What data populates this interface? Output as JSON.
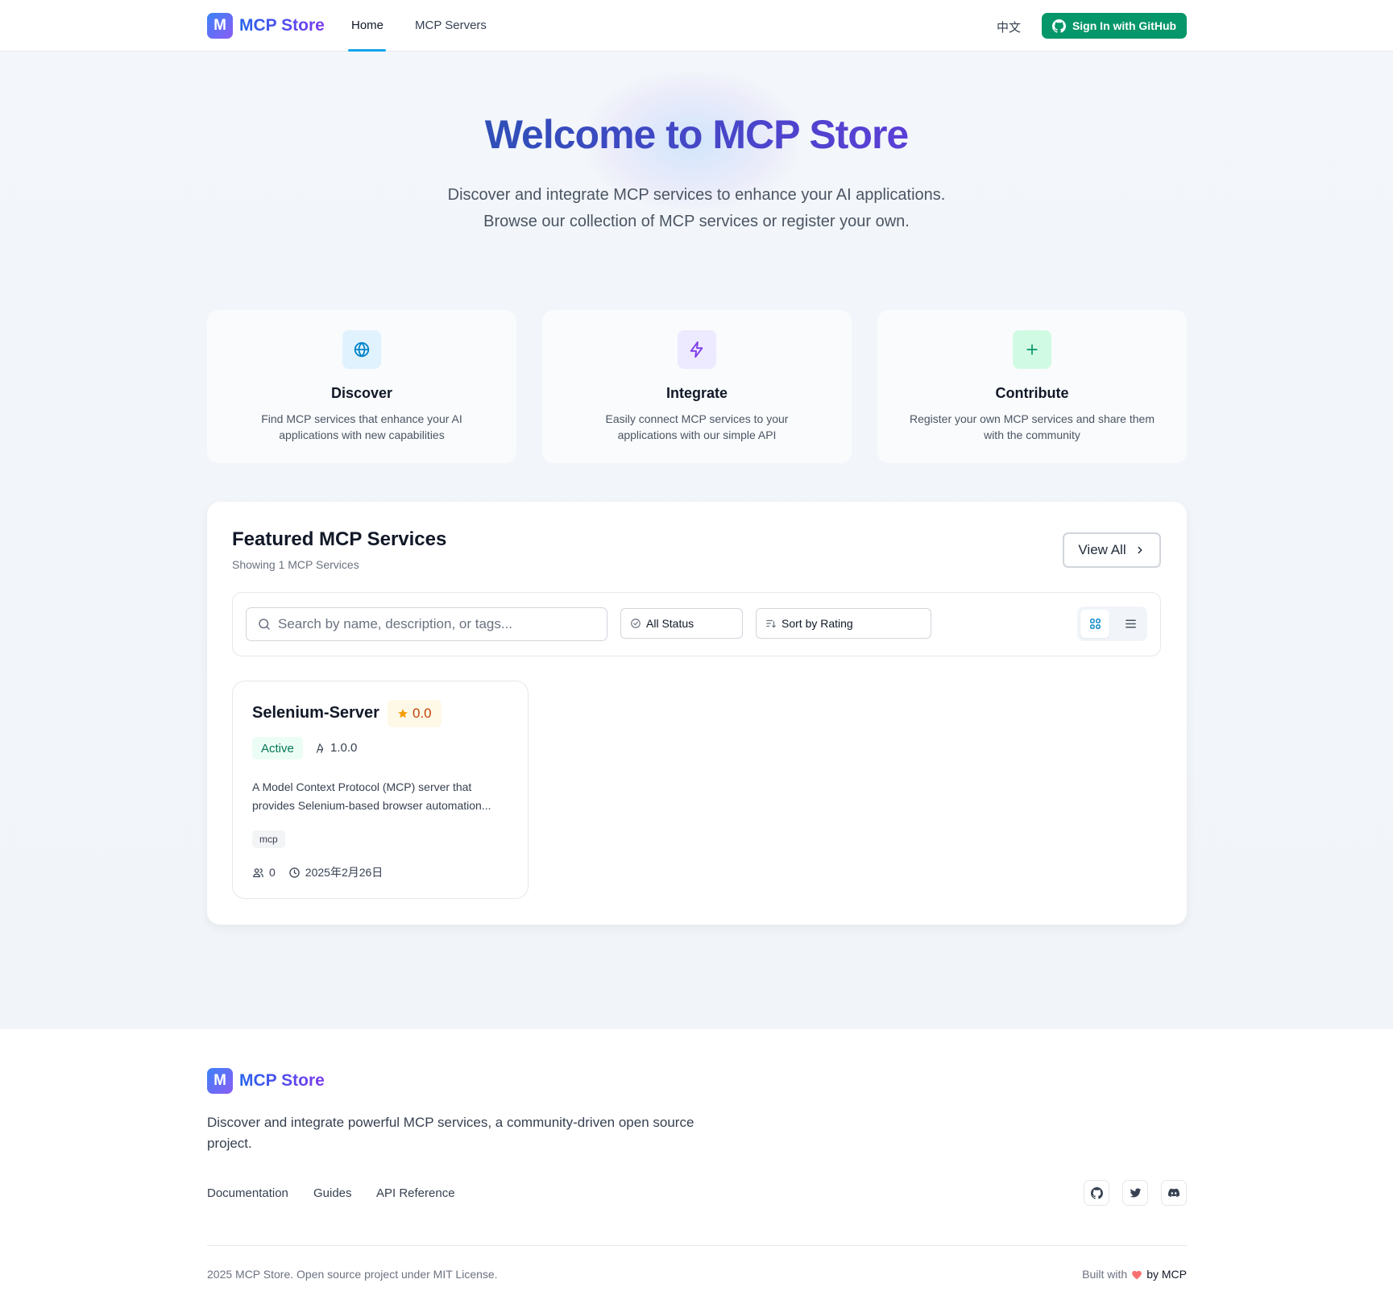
{
  "brand": {
    "logo_letter": "M",
    "name": "MCP Store",
    "gradient_start": "#3b82f6",
    "gradient_end": "#8b5cf6"
  },
  "nav": {
    "home": "Home",
    "servers": "MCP Servers",
    "language": "中文",
    "signin": "Sign In with GitHub",
    "active_indicator_color": "#0ea5e9",
    "signin_color": "#059669"
  },
  "hero": {
    "title": "Welcome to MCP Store",
    "line1": "Discover and integrate MCP services to enhance your AI applications.",
    "line2": "Browse our collection of MCP services or register your own."
  },
  "features": [
    {
      "icon": "globe-icon",
      "title": "Discover",
      "desc": "Find MCP services that enhance your AI applications with new capabilities",
      "color": "#0284c7",
      "bg": "#e0f2fe"
    },
    {
      "icon": "lightning-icon",
      "title": "Integrate",
      "desc": "Easily connect MCP services to your applications with our simple API",
      "color": "#7c3aed",
      "bg": "#ede9fe"
    },
    {
      "icon": "plus-icon",
      "title": "Contribute",
      "desc": "Register your own MCP services and share them with the community",
      "color": "#059669",
      "bg": "#d1fae5"
    }
  ],
  "featured": {
    "title": "Featured MCP Services",
    "subtitle": "Showing 1 MCP Services",
    "view_all": "View All",
    "search_placeholder": "Search by name, description, or tags...",
    "status_filter": "All Status",
    "sort": "Sort by Rating",
    "view_mode": "grid"
  },
  "services": [
    {
      "name": "Selenium-Server",
      "rating": "0.0",
      "status": "Active",
      "version": "1.0.0",
      "description": "A Model Context Protocol (MCP) server that provides Selenium-based browser automation...",
      "tags": [
        "mcp"
      ],
      "users": "0",
      "date": "2025年2月26日"
    }
  ],
  "footer": {
    "name": "MCP Store",
    "description": "Discover and integrate powerful MCP services, a community-driven open source project.",
    "links": [
      "Documentation",
      "Guides",
      "API Reference"
    ],
    "social": [
      "github-icon",
      "twitter-icon",
      "discord-icon"
    ],
    "copyright": "2025 MCP Store. Open source project under MIT License.",
    "built_prefix": "Built with",
    "built_suffix": "by MCP"
  }
}
